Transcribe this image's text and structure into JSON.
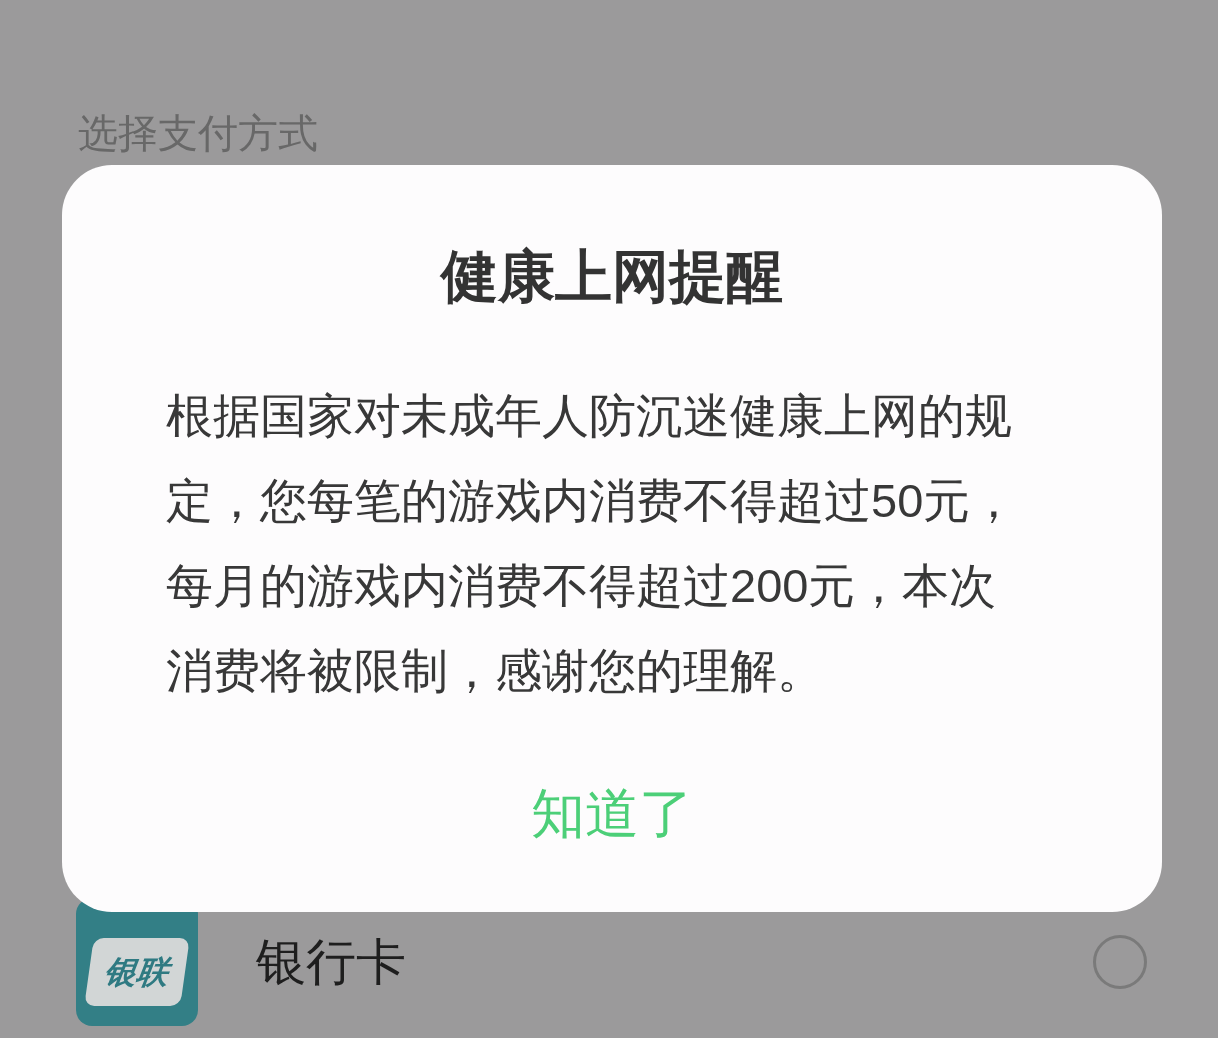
{
  "page": {
    "title": "选择支付方式"
  },
  "dialog": {
    "title": "健康上网提醒",
    "message": "根据国家对未成年人防沉迷健康上网的规定，您每笔的游戏内消费不得超过50元，每月的游戏内消费不得超过200元，本次消费将被限制，感谢您的理解。",
    "button": "知道了"
  },
  "payment_methods": [
    {
      "logo_text": "银联",
      "label": "银行卡",
      "selected": false
    }
  ]
}
